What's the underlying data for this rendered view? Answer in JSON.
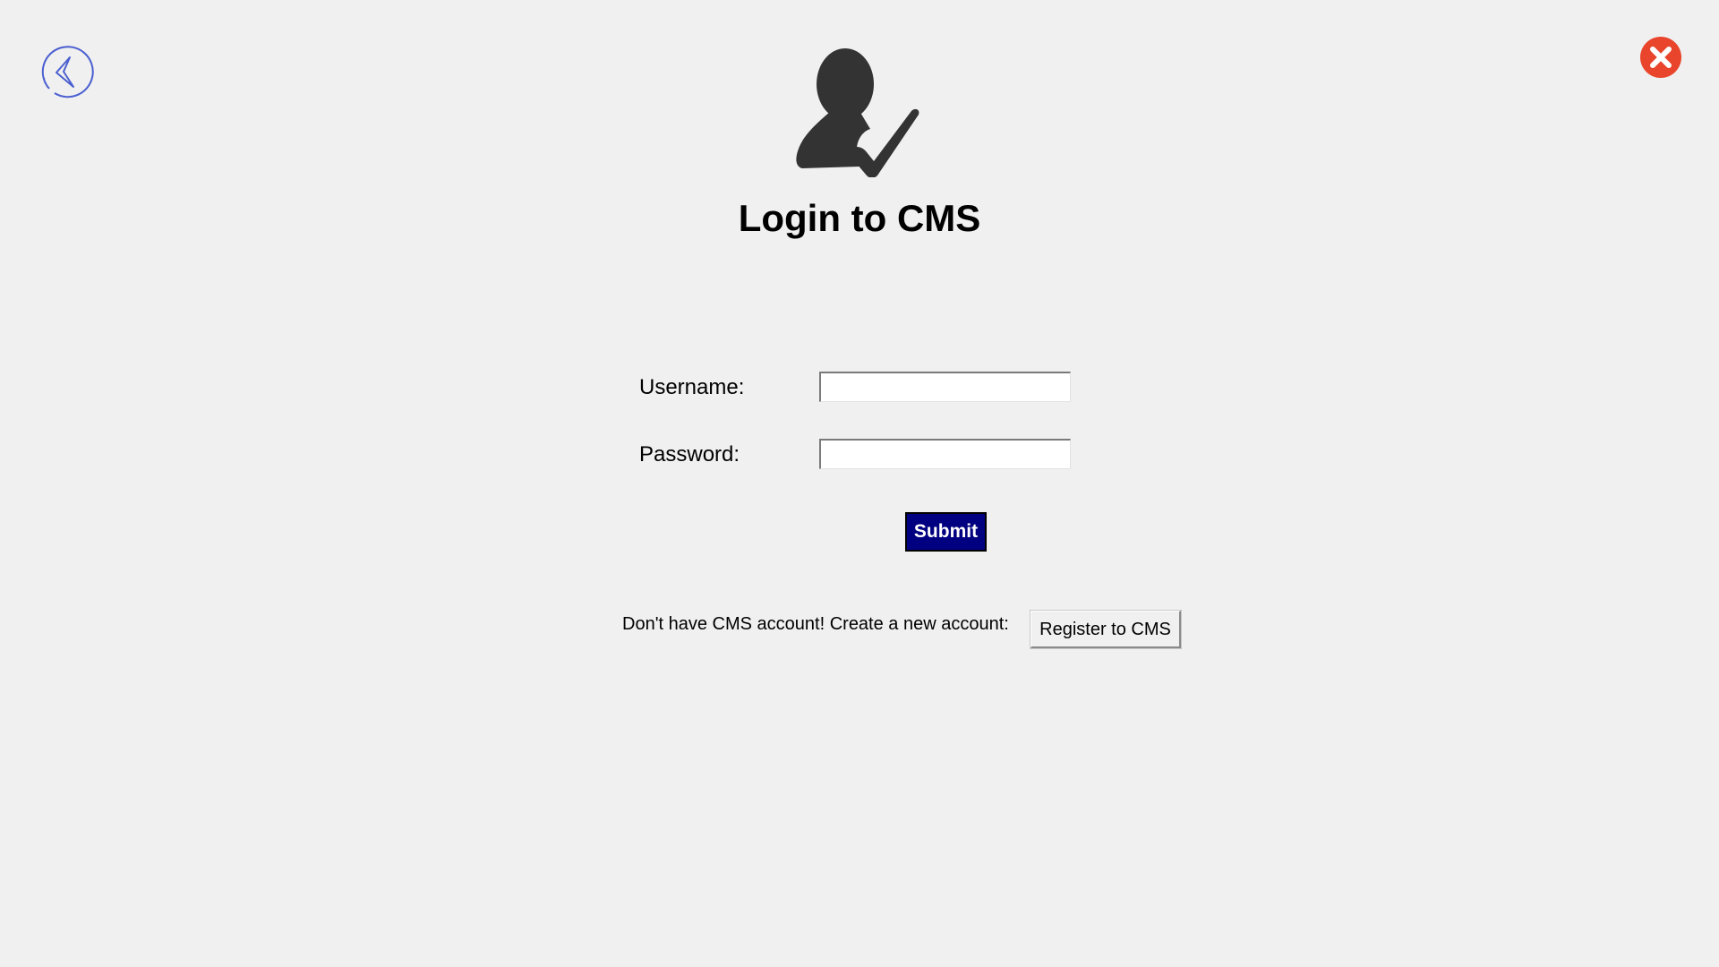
{
  "header": {
    "title": "Login to CMS",
    "back_icon": "back-arrow-icon",
    "close_icon": "close-icon",
    "user_icon": "user-check-icon"
  },
  "form": {
    "username_label": "Username:",
    "username_value": "",
    "password_label": "Password:",
    "password_value": "",
    "submit_label": "Submit"
  },
  "register": {
    "prompt": "Don't have CMS account! Create a new account:",
    "button_label": "Register to CMS"
  },
  "colors": {
    "background": "#f0f0f0",
    "submit_bg": "#000080",
    "back_icon": "#4a5fd0",
    "close_icon": "#e8452c",
    "user_icon": "#333333"
  }
}
